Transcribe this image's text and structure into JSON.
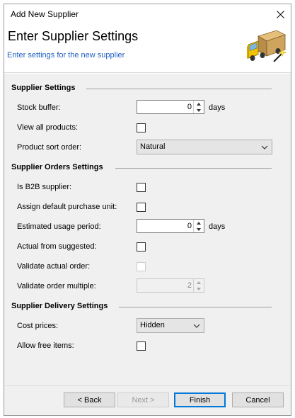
{
  "window": {
    "title": "Add New Supplier"
  },
  "header": {
    "title": "Enter Supplier Settings",
    "subtitle": "Enter settings for the new supplier",
    "icon": "truck-icon"
  },
  "sections": {
    "supplier_settings": {
      "title": "Supplier Settings",
      "stock_buffer": {
        "label": "Stock buffer:",
        "value": "0",
        "unit": "days"
      },
      "view_all_products": {
        "label": "View all products:",
        "checked": false
      },
      "product_sort_order": {
        "label": "Product sort order:",
        "value": "Natural"
      }
    },
    "supplier_orders_settings": {
      "title": "Supplier Orders Settings",
      "is_b2b_supplier": {
        "label": "Is B2B supplier:",
        "checked": false
      },
      "assign_default_purchase_unit": {
        "label": "Assign default purchase unit:",
        "checked": false
      },
      "estimated_usage_period": {
        "label": "Estimated usage period:",
        "value": "0",
        "unit": "days"
      },
      "actual_from_suggested": {
        "label": "Actual from suggested:",
        "checked": false
      },
      "validate_actual_order": {
        "label": "Validate actual order:",
        "checked": false,
        "enabled": false
      },
      "validate_order_multiple": {
        "label": "Validate order multiple:",
        "value": "2",
        "enabled": false
      }
    },
    "supplier_delivery_settings": {
      "title": "Supplier Delivery Settings",
      "cost_prices": {
        "label": "Cost prices:",
        "value": "Hidden"
      },
      "allow_free_items": {
        "label": "Allow free items:",
        "checked": false
      }
    }
  },
  "footer": {
    "back_label": "< Back",
    "next_label": "Next >",
    "finish_label": "Finish",
    "cancel_label": "Cancel"
  },
  "colors": {
    "subtitle": "#1f5fbf",
    "content_bg": "#f0f0f0",
    "accent": "#0078d7"
  }
}
